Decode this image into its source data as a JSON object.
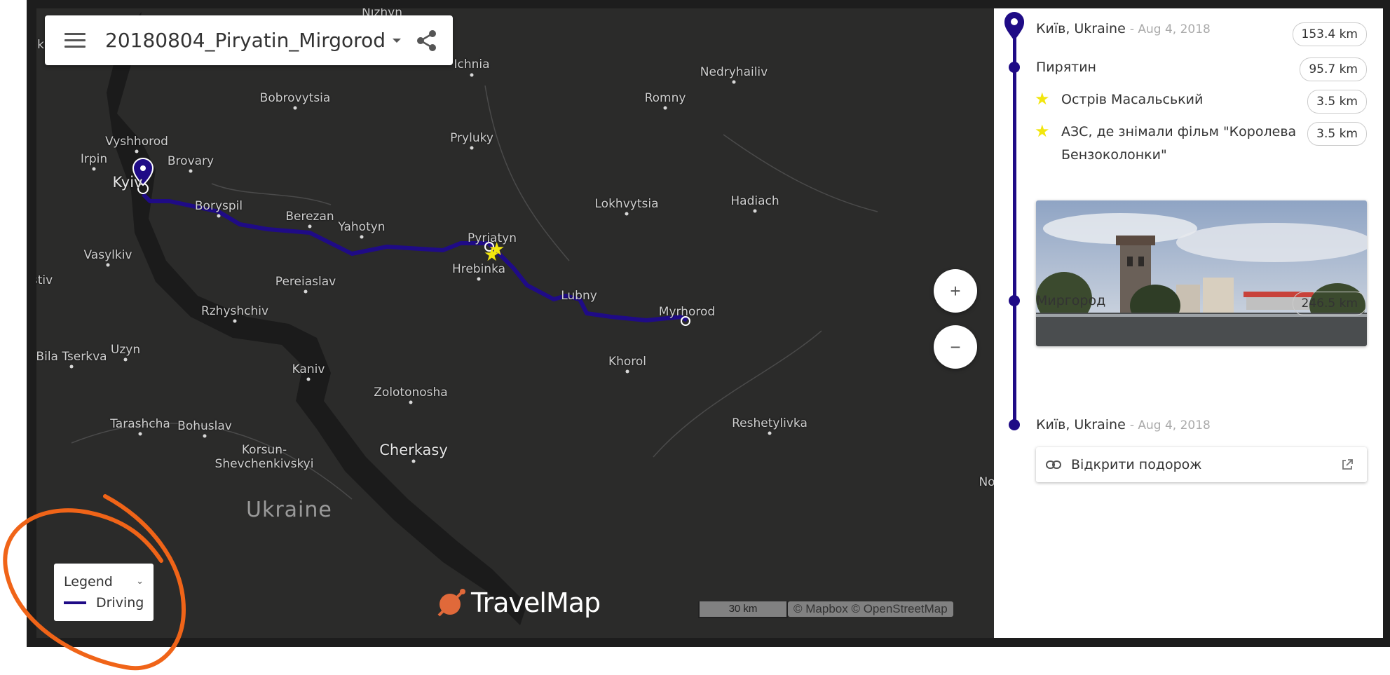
{
  "toolbar": {
    "title": "20180804_Piryatin_Mirgorod"
  },
  "map": {
    "cities": [
      {
        "name": "Nizhyn"
      },
      {
        "name": "Ichnia"
      },
      {
        "name": "Nedryhailiv"
      },
      {
        "name": "Bobrovytsia"
      },
      {
        "name": "Romny"
      },
      {
        "name": "Pryluky"
      },
      {
        "name": "Vyshhorod"
      },
      {
        "name": "Irpin"
      },
      {
        "name": "Brovary"
      },
      {
        "name": "Kyiv"
      },
      {
        "name": "Boryspil"
      },
      {
        "name": "Berezan"
      },
      {
        "name": "Yahotyn"
      },
      {
        "name": "Lokhvytsia"
      },
      {
        "name": "Hadiach"
      },
      {
        "name": "Pyriatyn"
      },
      {
        "name": "Hrebinka"
      },
      {
        "name": "Vasylkiv"
      },
      {
        "name": "Pereiaslav"
      },
      {
        "name": "Lubny"
      },
      {
        "name": "Myrhorod"
      },
      {
        "name": "Rzhyshchiv"
      },
      {
        "name": "Bila Tserkva"
      },
      {
        "name": "Uzyn"
      },
      {
        "name": "Khorol"
      },
      {
        "name": "Kaniv"
      },
      {
        "name": "Zolotonosha"
      },
      {
        "name": "Tarashcha"
      },
      {
        "name": "Bohuslav"
      },
      {
        "name": "Reshetylivka"
      },
      {
        "name": "Korsun-"
      },
      {
        "name": "Shevchenkivskyi"
      },
      {
        "name": "Cherkasy"
      },
      {
        "name": "stiv"
      },
      {
        "name": "No"
      },
      {
        "name": "k"
      }
    ],
    "country": "Ukraine",
    "route_color": "#1f0b86",
    "zoom_in": "+",
    "zoom_out": "−",
    "scale": "30 km",
    "attribution": "© Mapbox © OpenStreetMap",
    "brand": "TravelMap"
  },
  "legend": {
    "title": "Legend",
    "items": [
      {
        "label": "Driving",
        "color": "#1f0b86"
      }
    ]
  },
  "sidebar": {
    "start": {
      "place": "Київ, Ukraine",
      "date": "- Aug 4, 2018",
      "distance": "153.4 km"
    },
    "stop1": {
      "place": "Пирятин",
      "distance": "95.7 km"
    },
    "poi1": {
      "name": "Острів Масальський",
      "distance": "3.5 km"
    },
    "poi2": {
      "name": "АЗС, де знімали фільм \"Королева Бензоколонки\"",
      "distance": "3.5 km"
    },
    "stop2": {
      "place": "Миргород",
      "distance": "246.5 km"
    },
    "end": {
      "place": "Київ, Ukraine",
      "date": "- Aug 4, 2018"
    },
    "open_trip": "Відкрити подорож"
  },
  "colors": {
    "accent": "#1f0b86",
    "poi_star": "#f2e60e",
    "annotation": "#f06418"
  }
}
